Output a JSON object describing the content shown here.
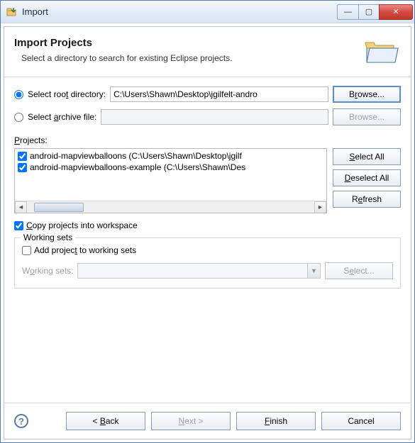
{
  "titlebar": {
    "title": "Import",
    "min": "—",
    "max": "▢",
    "close": "✕"
  },
  "banner": {
    "title": "Import Projects",
    "desc": "Select a directory to search for existing Eclipse projects."
  },
  "rootDir": {
    "label_pre": "Select roo",
    "label_u": "t",
    "label_post": " directory:",
    "value": "C:\\Users\\Shawn\\Desktop\\jgilfelt-andro",
    "browse_pre": "B",
    "browse_u": "r",
    "browse_post": "owse..."
  },
  "archive": {
    "label_pre": "Select ",
    "label_u": "a",
    "label_post": "rchive file:",
    "value": "",
    "browse_pre": "B",
    "browse_u": "r",
    "browse_post": "owse..."
  },
  "projects": {
    "label_u": "P",
    "label_post": "rojects:",
    "items": [
      {
        "text": "android-mapviewballoons (C:\\Users\\Shawn\\Desktop\\jgilf"
      },
      {
        "text": "android-mapviewballoons-example (C:\\Users\\Shawn\\Des"
      }
    ],
    "selectAll_u": "S",
    "selectAll_post": "elect All",
    "deselectAll_u": "D",
    "deselectAll_post": "eselect All",
    "refresh_pre": "R",
    "refresh_u": "e",
    "refresh_post": "fresh"
  },
  "copy": {
    "label_u": "C",
    "label_post": "opy projects into workspace"
  },
  "workingSets": {
    "legend": "Working sets",
    "add_pre": "Add projec",
    "add_u": "t",
    "add_post": " to working sets",
    "label_pre": "W",
    "label_u": "o",
    "label_post": "rking sets:",
    "select_pre": "S",
    "select_u": "e",
    "select_post": "lect..."
  },
  "footer": {
    "help": "?",
    "back_pre": "< ",
    "back_u": "B",
    "back_post": "ack",
    "next_u": "N",
    "next_post": "ext >",
    "finish_u": "F",
    "finish_post": "inish",
    "cancel": "Cancel"
  }
}
